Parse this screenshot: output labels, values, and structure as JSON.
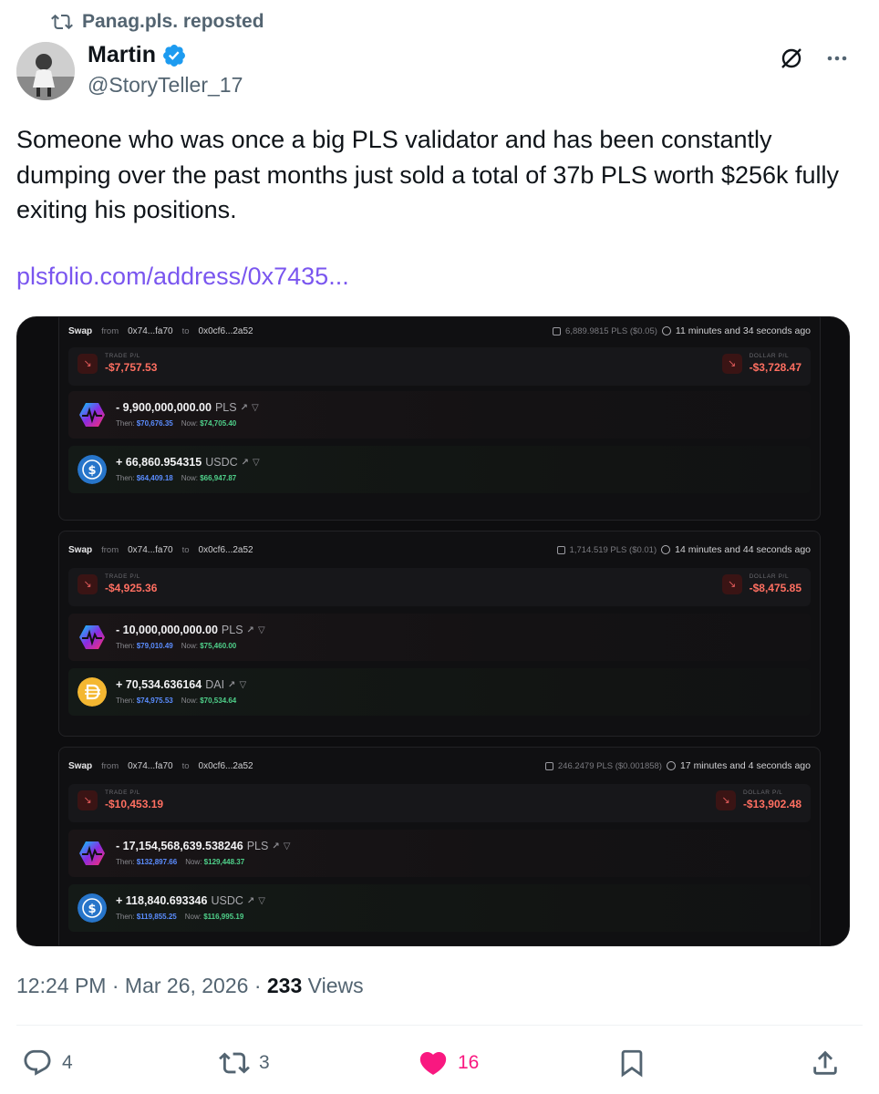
{
  "repost": {
    "text": "Panag.pls. reposted"
  },
  "author": {
    "name": "Martin",
    "handle": "@StoryTeller_17"
  },
  "tweet": {
    "text": "Someone who was once a big PLS validator and has been constantly dumping over the past months just sold a total of 37b PLS worth $256k fully exiting his positions.",
    "link": "plsfolio.com/address/0x7435..."
  },
  "media": {
    "cards": [
      {
        "swap": "Swap",
        "from_label": "from",
        "from": "0x74...fa70",
        "to_label": "to",
        "to": "0x0cf6...2a52",
        "gas": "6,889.9815 PLS ($0.05)",
        "time": "11 minutes and 34 seconds ago",
        "trade_label": "TRADE P/L",
        "trade_pl": "-$7,757.53",
        "dollar_label": "DOLLAR P/L",
        "dollar_pl": "-$3,728.47",
        "sell": {
          "amount": "- 9,900,000,000.00",
          "symbol": "PLS",
          "then_label": "Then:",
          "then": "$70,676.35",
          "now_label": "Now:",
          "now": "$74,705.40"
        },
        "buy": {
          "amount": "+ 66,860.954315",
          "symbol": "USDC",
          "then_label": "Then:",
          "then": "$64,409.18",
          "now_label": "Now:",
          "now": "$66,947.87"
        }
      },
      {
        "swap": "Swap",
        "from_label": "from",
        "from": "0x74...fa70",
        "to_label": "to",
        "to": "0x0cf6...2a52",
        "gas": "1,714.519 PLS ($0.01)",
        "time": "14 minutes and 44 seconds ago",
        "trade_label": "TRADE P/L",
        "trade_pl": "-$4,925.36",
        "dollar_label": "DOLLAR P/L",
        "dollar_pl": "-$8,475.85",
        "sell": {
          "amount": "- 10,000,000,000.00",
          "symbol": "PLS",
          "then_label": "Then:",
          "then": "$79,010.49",
          "now_label": "Now:",
          "now": "$75,460.00"
        },
        "buy": {
          "amount": "+ 70,534.636164",
          "symbol": "DAI",
          "then_label": "Then:",
          "then": "$74,975.53",
          "now_label": "Now:",
          "now": "$70,534.64"
        }
      },
      {
        "swap": "Swap",
        "from_label": "from",
        "from": "0x74...fa70",
        "to_label": "to",
        "to": "0x0cf6...2a52",
        "gas": "246.2479 PLS ($0.001858)",
        "time": "17 minutes and 4 seconds ago",
        "trade_label": "TRADE P/L",
        "trade_pl": "-$10,453.19",
        "dollar_label": "DOLLAR P/L",
        "dollar_pl": "-$13,902.48",
        "sell": {
          "amount": "- 17,154,568,639.538246",
          "symbol": "PLS",
          "then_label": "Then:",
          "then": "$132,897.66",
          "now_label": "Now:",
          "now": "$129,448.37"
        },
        "buy": {
          "amount": "+ 118,840.693346",
          "symbol": "USDC",
          "then_label": "Then:",
          "then": "$119,855.25",
          "now_label": "Now:",
          "now": "$116,995.19"
        }
      }
    ]
  },
  "meta": {
    "time": "12:24 PM",
    "sep1": "·",
    "date": "Mar 26, 2026",
    "sep2": "·",
    "views": "233",
    "views_label": "Views"
  },
  "actions": {
    "replies": "4",
    "reposts": "3",
    "likes": "16"
  },
  "colors": {
    "link": "#7a56ef",
    "like": "#f91880",
    "verified": "#1d9bf0"
  },
  "icons": [
    "repost-icon",
    "verified-icon",
    "grok-icon",
    "more-icon",
    "reply-icon",
    "like-icon",
    "bookmark-icon",
    "share-icon"
  ]
}
